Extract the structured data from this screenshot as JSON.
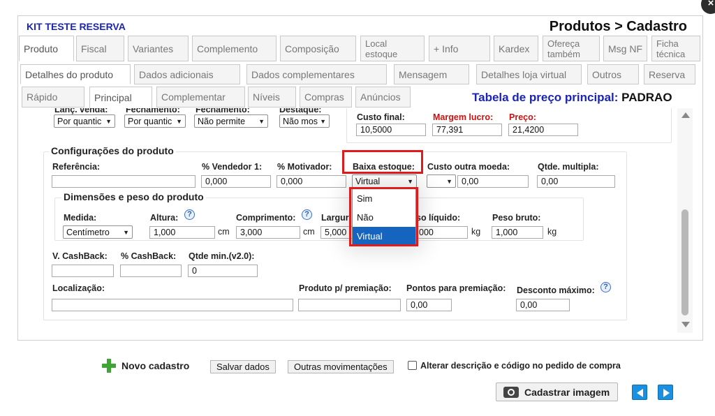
{
  "header": {
    "kit_name": "KIT TESTE RESERVA",
    "breadcrumb": "Produtos > Cadastro"
  },
  "tabs_row1": [
    "Produto",
    "Fiscal",
    "Variantes",
    "Complemento",
    "Composição",
    "Local estoque",
    "+ Info",
    "Kardex",
    "Ofereça também",
    "Msg NF",
    "Ficha técnica"
  ],
  "tabs_row2": [
    "Detalhes do produto",
    "Dados adicionais",
    "Dados complementares",
    "Mensagem",
    "Detalhes loja virtual",
    "Outros",
    "Reserva"
  ],
  "tabs_row3": [
    "Rápido",
    "Principal",
    "Complementar",
    "Níveis",
    "Compras",
    "Anúncios"
  ],
  "price_table": {
    "label": "Tabela de preço principal:",
    "value": "PADRAO"
  },
  "top_partial": {
    "labels": [
      "Lanç. venda:",
      "Fechamento:",
      "Fechamento:",
      "Destaque:"
    ],
    "selects": [
      "Por quantic",
      "Por quantic",
      "Não permite",
      "Não mos"
    ]
  },
  "pricing": {
    "custo_final_label": "Custo final:",
    "custo_final": "10,5000",
    "margem_label": "Margem lucro:",
    "margem": "77,391",
    "preco_label": "Preço:",
    "preco": "21,4200"
  },
  "config": {
    "title": "Configurações do produto",
    "referencia_label": "Referência:",
    "referencia": "",
    "vendedor_label": "% Vendedor 1:",
    "vendedor": "0,000",
    "motivador_label": "% Motivador:",
    "motivador": "0,000",
    "baixa_label": "Baixa estoque:",
    "baixa_value": "Virtual",
    "custo_moeda_label": "Custo outra moeda:",
    "custo_moeda": "0,00",
    "multipla_label": "Qtde. multipla:",
    "multipla": "0,00"
  },
  "dimensions": {
    "title": "Dimensões e peso do produto",
    "medida_label": "Medida:",
    "medida": "Centímetro",
    "altura_label": "Altura:",
    "altura": "1,000",
    "comprimento_label": "Comprimento:",
    "comprimento": "3,000",
    "largura_label": "Largur",
    "largura": "5,000",
    "peso_liquido_label": "so líquido:",
    "peso_liquido": "000",
    "peso_bruto_label": "Peso bruto:",
    "peso_bruto": "1,000",
    "unit_cm": "cm",
    "unit_kg": "kg"
  },
  "cashback": {
    "v_label": "V. CashBack:",
    "v": "",
    "pct_label": "% CashBack:",
    "pct": "",
    "qtde_label": "Qtde min.(v2.0):",
    "qtde": "0"
  },
  "location": {
    "localizacao_label": "Localização:",
    "localizacao": "",
    "premiacao_label": "Produto p/ premiação:",
    "premiacao": "",
    "pontos_label": "Pontos para premiação:",
    "pontos": "0,00",
    "desconto_label": "Desconto máximo:",
    "desconto": "0,00"
  },
  "dropdown_options": [
    "Sim",
    "Não",
    "Virtual"
  ],
  "dropdown_selected": "Virtual",
  "footer": {
    "novo": "Novo cadastro",
    "salvar": "Salvar dados",
    "outras": "Outras movimentações",
    "alterar": "Alterar descrição e código no pedido de compra",
    "cadastrar_imagem": "Cadastrar imagem"
  },
  "icons": {
    "help": "help-circle-icon",
    "camera": "camera-icon",
    "plus": "plus-icon",
    "prev": "arrow-left-icon",
    "next": "arrow-right-icon",
    "close": "close-icon",
    "chevron": "chevron-down-icon"
  },
  "colors": {
    "title_blue": "#1a24b8",
    "highlight_red": "#e01b1b",
    "selected_blue": "#1565c0",
    "plus_green": "#3fa535"
  }
}
